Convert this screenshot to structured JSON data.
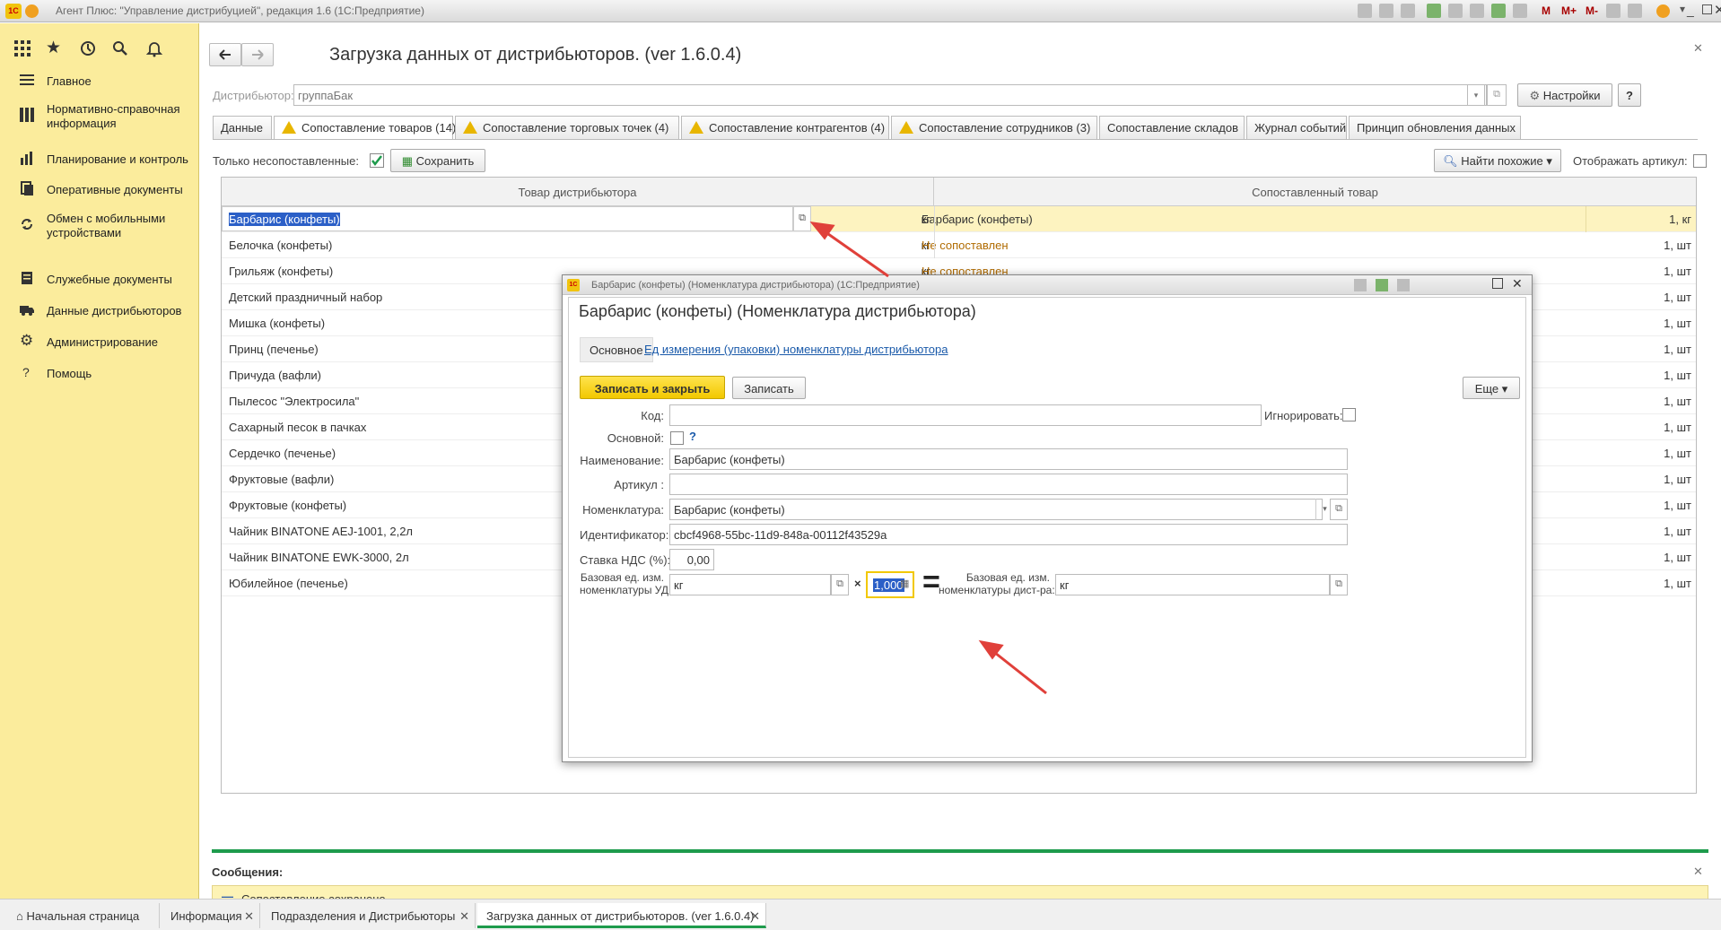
{
  "window": {
    "title": "Агент Плюс: \"Управление дистрибуцией\", редакция 1.6  (1С:Предприятие)",
    "toolbar_m": [
      "M",
      "M+",
      "M-"
    ]
  },
  "sidebar": {
    "items": [
      {
        "label": "Главное",
        "icon": "menu-lines-icon"
      },
      {
        "label": "Нормативно-справочная информация",
        "icon": "grid-icon"
      },
      {
        "label": "Планирование и контроль",
        "icon": "chart-icon"
      },
      {
        "label": "Оперативные документы",
        "icon": "documents-icon"
      },
      {
        "label": "Обмен с мобильными устройствами",
        "icon": "sync-icon"
      },
      {
        "label": "Служебные документы",
        "icon": "service-docs-icon"
      },
      {
        "label": "Данные дистрибьюторов",
        "icon": "truck-icon"
      },
      {
        "label": "Администрирование",
        "icon": "gear-icon"
      },
      {
        "label": "Помощь",
        "icon": "question-icon"
      }
    ]
  },
  "form": {
    "title": "Загрузка данных от дистрибьюторов. (ver 1.6.0.4)",
    "distributor_label": "Дистрибьютор:",
    "distributor_value": "группаБак",
    "settings_button": "Настройки",
    "help_button": "?",
    "tabs": [
      {
        "label": "Данные",
        "warn": false
      },
      {
        "label": "Сопоставление товаров (14)",
        "warn": true
      },
      {
        "label": "Сопоставление торговых точек (4)",
        "warn": true
      },
      {
        "label": "Сопоставление контрагентов (4)",
        "warn": true
      },
      {
        "label": "Сопоставление сотрудников (3)",
        "warn": true
      },
      {
        "label": "Сопоставление складов",
        "warn": false
      },
      {
        "label": "Журнал событий",
        "warn": false
      },
      {
        "label": "Принцип обновления данных",
        "warn": false
      }
    ],
    "only_unmatched_label": "Только несопоставленные:",
    "save_button": "Сохранить",
    "find_similar_button": "Найти похожие",
    "show_article_label": "Отображать артикул:",
    "grid": {
      "col_left": "Товар дистрибьютора",
      "col_right": "Сопоставленный товар",
      "rows": [
        {
          "name": "Барбарис (конфеты)",
          "unit": "кг",
          "matched": "Барбарис (конфеты)",
          "qty": "1, кг"
        },
        {
          "name": "Белочка (конфеты)",
          "unit": "кг",
          "matched": "Не сопоставлен",
          "qty": "1, шт"
        },
        {
          "name": "Грильяж (конфеты)",
          "unit": "кг",
          "matched": "Не сопоставлен",
          "qty": "1, шт"
        },
        {
          "name": "Детский праздничный набор",
          "unit": "",
          "matched": "",
          "qty": "1, шт"
        },
        {
          "name": "Мишка (конфеты)",
          "unit": "",
          "matched": "",
          "qty": "1, шт"
        },
        {
          "name": "Принц (печенье)",
          "unit": "",
          "matched": "",
          "qty": "1, шт"
        },
        {
          "name": "Причуда (вафли)",
          "unit": "",
          "matched": "",
          "qty": "1, шт"
        },
        {
          "name": "Пылесос \"Электросила\"",
          "unit": "",
          "matched": "",
          "qty": "1, шт"
        },
        {
          "name": "Сахарный песок в пачках",
          "unit": "",
          "matched": "",
          "qty": "1, шт"
        },
        {
          "name": "Сердечко (печенье)",
          "unit": "",
          "matched": "",
          "qty": "1, шт"
        },
        {
          "name": "Фруктовые (вафли)",
          "unit": "",
          "matched": "",
          "qty": "1, шт"
        },
        {
          "name": "Фруктовые (конфеты)",
          "unit": "",
          "matched": "",
          "qty": "1, шт"
        },
        {
          "name": "Чайник BINATONE  AEJ-1001,  2,2л",
          "unit": "",
          "matched": "",
          "qty": "1, шт"
        },
        {
          "name": "Чайник BINATONE  EWK-3000,  2л",
          "unit": "",
          "matched": "",
          "qty": "1, шт"
        },
        {
          "name": "Юбилейное (печенье)",
          "unit": "",
          "matched": "",
          "qty": "1, шт"
        }
      ]
    }
  },
  "messages": {
    "title": "Сообщения:",
    "text": "Сопоставление сохранено."
  },
  "taskbar": {
    "items": [
      "Начальная страница",
      "Информация",
      "Подразделения и Дистрибьюторы",
      "Загрузка данных от дистрибьюторов. (ver 1.6.0.4)"
    ]
  },
  "dialog": {
    "window_title": "Барбарис (конфеты) (Номенклатура дистрибьютора)  (1С:Предприятие)",
    "title": "Барбарис (конфеты) (Номенклатура дистрибьютора)",
    "tab_main": "Основное",
    "tab_units": "Ед измерения (упаковки)  номенклатуры дистрибьютора",
    "write_close_button": "Записать и закрыть",
    "write_button": "Записать",
    "more_button": "Еще",
    "fields": {
      "code_label": "Код:",
      "code_value": "",
      "ignore_label": "Игнорировать:",
      "main_label": "Основной:",
      "main_help": "?",
      "name_label": "Наименование:",
      "name_value": "Барбарис (конфеты)",
      "article_label": "Артикул :",
      "article_value": "",
      "nomenclature_label": "Номенклатура:",
      "nomenclature_value": "Барбарис (конфеты)",
      "id_label": "Идентификатор:",
      "id_value": "cbcf4968-55bc-11d9-848a-00112f43529a",
      "vat_label": "Ставка НДС (%):",
      "vat_value": "0,00",
      "base_unit_ud_label_1": "Базовая ед. изм.",
      "base_unit_ud_label_2": "номенклатуры УД:",
      "base_unit_ud_value": "кг",
      "multiply": "×",
      "coef_value": "1,000",
      "equals": "=",
      "base_unit_dist_label_1": "Базовая ед. изм.",
      "base_unit_dist_label_2": "номенклатуры дист-ра:",
      "base_unit_dist_value": "кг"
    }
  },
  "colors": {
    "sidebar_bg": "#fbec9c",
    "primary_button": "#f5d21a",
    "accent_green": "#1e9b4c",
    "arrow_red": "#e0403a",
    "unmatched_text": "#b06b00"
  }
}
